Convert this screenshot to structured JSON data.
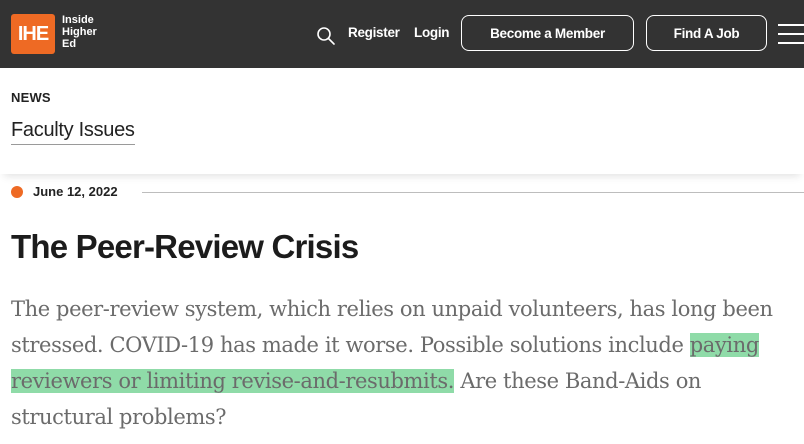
{
  "header": {
    "logo_mark": "IHE",
    "logo_lines": [
      "Inside",
      "Higher",
      "Ed"
    ],
    "search_icon": "search-icon",
    "register_label": "Register",
    "login_label": "Login",
    "become_member_label": "Become a Member",
    "find_job_label": "Find A Job",
    "menu_icon": "hamburger-menu-icon",
    "colors": {
      "bar": "#333333",
      "logo": "#ee6a24"
    }
  },
  "section": {
    "category": "NEWS",
    "title": "Faculty Issues"
  },
  "article": {
    "date": "June 12, 2022",
    "headline": "The Peer-Review Crisis",
    "dek_before": "The peer-review system, which relies on unpaid volunteers, has long been stressed. COVID-19 has made it worse. Possible solutions include ",
    "dek_highlight": "paying reviewers or limiting revise-and-resubmits.",
    "dek_after": " Are these Band-Aids on structural problems?",
    "colors": {
      "highlight": "#8fdba8",
      "date_dot": "#ee6a24"
    }
  }
}
